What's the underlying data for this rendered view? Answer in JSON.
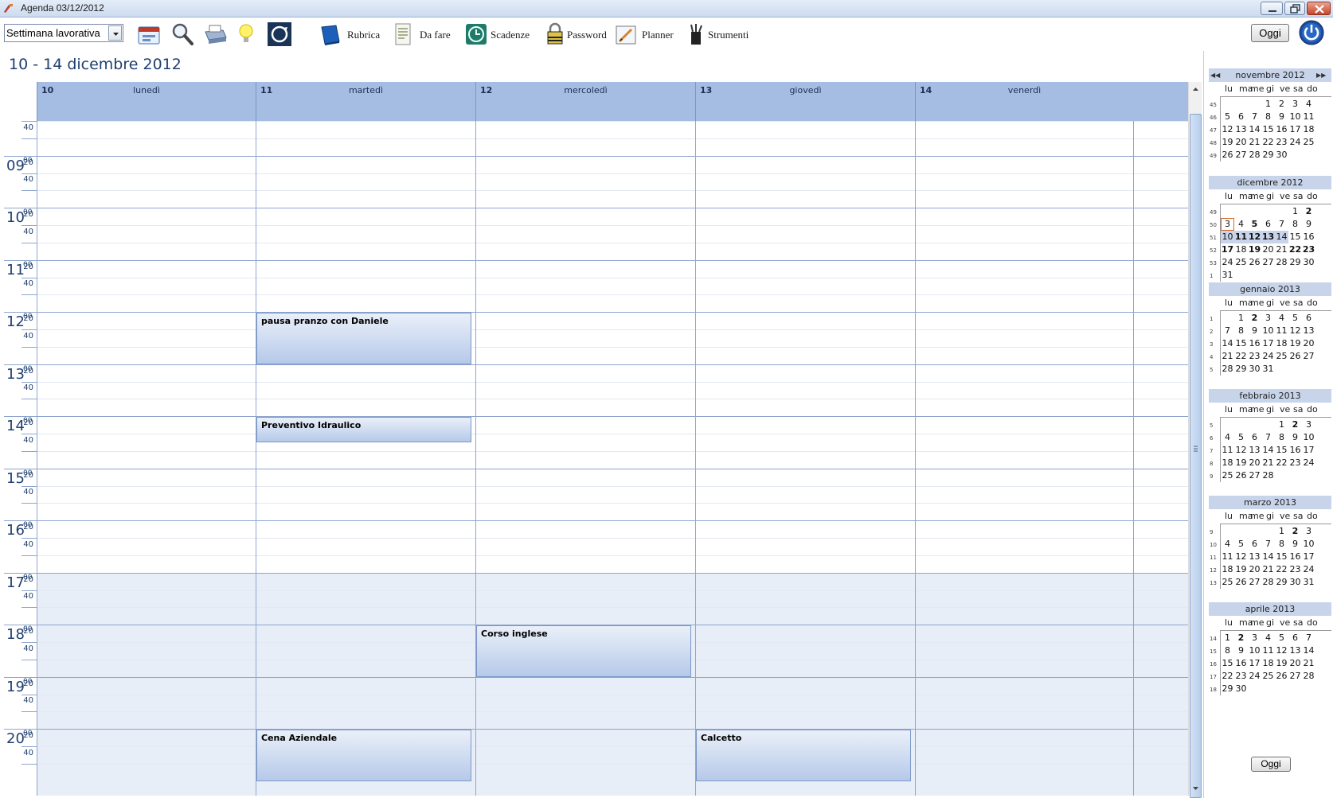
{
  "window": {
    "title": "Agenda 03/12/2012"
  },
  "toolbar": {
    "view_select": "Settimana lavorativa",
    "buttons": [
      {
        "label": "Rubrica",
        "icon": "address-book-icon"
      },
      {
        "label": "Da fare",
        "icon": "todo-list-icon"
      },
      {
        "label": "Scadenze",
        "icon": "deadline-clock-icon"
      },
      {
        "label": "Password",
        "icon": "password-lock-icon"
      },
      {
        "label": "Planner",
        "icon": "planner-icon"
      },
      {
        "label": "Strumenti",
        "icon": "tools-icon"
      }
    ],
    "oggi": "Oggi"
  },
  "main": {
    "date_range": "10 - 14 dicembre 2012",
    "days": [
      {
        "num": "10",
        "name": "lunedì"
      },
      {
        "num": "11",
        "name": "martedì"
      },
      {
        "num": "12",
        "name": "mercoledì"
      },
      {
        "num": "13",
        "name": "giovedì"
      },
      {
        "num": "14",
        "name": "venerdì"
      }
    ],
    "hours": [
      "09",
      "10",
      "11",
      "12",
      "13",
      "14",
      "15",
      "16",
      "17",
      "18",
      "19",
      "20"
    ],
    "hour_sup": "00",
    "minute_labels": [
      "20",
      "40"
    ],
    "events": [
      {
        "day": 1,
        "start": "12:00",
        "end": "13:00",
        "title": "pausa pranzo con Daniele"
      },
      {
        "day": 1,
        "start": "14:00",
        "end": "14:30",
        "title": "Preventivo Idraulico"
      },
      {
        "day": 2,
        "start": "18:00",
        "end": "19:00",
        "title": "Corso inglese"
      },
      {
        "day": 1,
        "start": "20:00",
        "end": "21:00",
        "title": "Cena Aziendale"
      },
      {
        "day": 3,
        "start": "20:00",
        "end": "21:00",
        "title": "Calcetto"
      }
    ]
  },
  "mini_calendars": {
    "weekdays": [
      "lu",
      "ma",
      "me",
      "gi",
      "ve",
      "sa",
      "do"
    ],
    "months": [
      {
        "title": "novembre 2012",
        "nav": true,
        "weeks": [
          {
            "wk": "45",
            "days": [
              "",
              "",
              "",
              "1",
              "2",
              "3",
              "4"
            ]
          },
          {
            "wk": "46",
            "days": [
              "5",
              "6",
              "7",
              "8",
              "9",
              "10",
              "11"
            ]
          },
          {
            "wk": "47",
            "days": [
              "12",
              "13",
              "14",
              "15",
              "16",
              "17",
              "18"
            ]
          },
          {
            "wk": "48",
            "days": [
              "19",
              "20",
              "21",
              "22",
              "23",
              "24",
              "25"
            ]
          },
          {
            "wk": "49",
            "days": [
              "26",
              "27",
              "28",
              "29",
              "30",
              "",
              ""
            ]
          }
        ],
        "bold": [],
        "selweek": -1,
        "today": null
      },
      {
        "title": "dicembre 2012",
        "nav": false,
        "weeks": [
          {
            "wk": "49",
            "days": [
              "",
              "",
              "",
              "",
              "",
              "1",
              "2"
            ]
          },
          {
            "wk": "50",
            "days": [
              "3",
              "4",
              "5",
              "6",
              "7",
              "8",
              "9"
            ]
          },
          {
            "wk": "51",
            "days": [
              "10",
              "11",
              "12",
              "13",
              "14",
              "15",
              "16"
            ]
          },
          {
            "wk": "52",
            "days": [
              "17",
              "18",
              "19",
              "20",
              "21",
              "22",
              "23"
            ]
          },
          {
            "wk": "53",
            "days": [
              "24",
              "25",
              "26",
              "27",
              "28",
              "29",
              "30"
            ]
          },
          {
            "wk": "1",
            "days": [
              "31",
              "",
              "",
              "",
              "",
              "",
              ""
            ]
          }
        ],
        "bold": [
          "2",
          "5",
          "11",
          "12",
          "13",
          "17",
          "19",
          "22",
          "23"
        ],
        "selweek": 2,
        "today": "3"
      },
      {
        "title": "gennaio 2013",
        "nav": false,
        "weeks": [
          {
            "wk": "1",
            "days": [
              "",
              "1",
              "2",
              "3",
              "4",
              "5",
              "6"
            ]
          },
          {
            "wk": "2",
            "days": [
              "7",
              "8",
              "9",
              "10",
              "11",
              "12",
              "13"
            ]
          },
          {
            "wk": "3",
            "days": [
              "14",
              "15",
              "16",
              "17",
              "18",
              "19",
              "20"
            ]
          },
          {
            "wk": "4",
            "days": [
              "21",
              "22",
              "23",
              "24",
              "25",
              "26",
              "27"
            ]
          },
          {
            "wk": "5",
            "days": [
              "28",
              "29",
              "30",
              "31",
              "",
              "",
              ""
            ]
          }
        ],
        "bold": [
          "2"
        ],
        "selweek": -1,
        "today": null
      },
      {
        "title": "febbraio 2013",
        "nav": false,
        "weeks": [
          {
            "wk": "5",
            "days": [
              "",
              "",
              "",
              "",
              "1",
              "2",
              "3"
            ]
          },
          {
            "wk": "6",
            "days": [
              "4",
              "5",
              "6",
              "7",
              "8",
              "9",
              "10"
            ]
          },
          {
            "wk": "7",
            "days": [
              "11",
              "12",
              "13",
              "14",
              "15",
              "16",
              "17"
            ]
          },
          {
            "wk": "8",
            "days": [
              "18",
              "19",
              "20",
              "21",
              "22",
              "23",
              "24"
            ]
          },
          {
            "wk": "9",
            "days": [
              "25",
              "26",
              "27",
              "28",
              "",
              "",
              ""
            ]
          }
        ],
        "bold": [
          "2"
        ],
        "selweek": -1,
        "today": null
      },
      {
        "title": "marzo 2013",
        "nav": false,
        "weeks": [
          {
            "wk": "9",
            "days": [
              "",
              "",
              "",
              "",
              "1",
              "2",
              "3"
            ]
          },
          {
            "wk": "10",
            "days": [
              "4",
              "5",
              "6",
              "7",
              "8",
              "9",
              "10"
            ]
          },
          {
            "wk": "11",
            "days": [
              "11",
              "12",
              "13",
              "14",
              "15",
              "16",
              "17"
            ]
          },
          {
            "wk": "12",
            "days": [
              "18",
              "19",
              "20",
              "21",
              "22",
              "23",
              "24"
            ]
          },
          {
            "wk": "13",
            "days": [
              "25",
              "26",
              "27",
              "28",
              "29",
              "30",
              "31"
            ]
          }
        ],
        "bold": [
          "2"
        ],
        "selweek": -1,
        "today": null
      },
      {
        "title": "aprile 2013",
        "nav": false,
        "weeks": [
          {
            "wk": "14",
            "days": [
              "1",
              "2",
              "3",
              "4",
              "5",
              "6",
              "7"
            ]
          },
          {
            "wk": "15",
            "days": [
              "8",
              "9",
              "10",
              "11",
              "12",
              "13",
              "14"
            ]
          },
          {
            "wk": "16",
            "days": [
              "15",
              "16",
              "17",
              "18",
              "19",
              "20",
              "21"
            ]
          },
          {
            "wk": "17",
            "days": [
              "22",
              "23",
              "24",
              "25",
              "26",
              "27",
              "28"
            ]
          },
          {
            "wk": "18",
            "days": [
              "29",
              "30",
              "",
              "",
              "",
              "",
              ""
            ]
          }
        ],
        "bold": [
          "2"
        ],
        "selweek": -1,
        "today": null
      }
    ],
    "oggi": "Oggi"
  },
  "colors": {
    "header": "#a6bde3",
    "accent": "#1f3f6f",
    "evening": "#e8eef8",
    "today_border": "#d46a2a"
  }
}
